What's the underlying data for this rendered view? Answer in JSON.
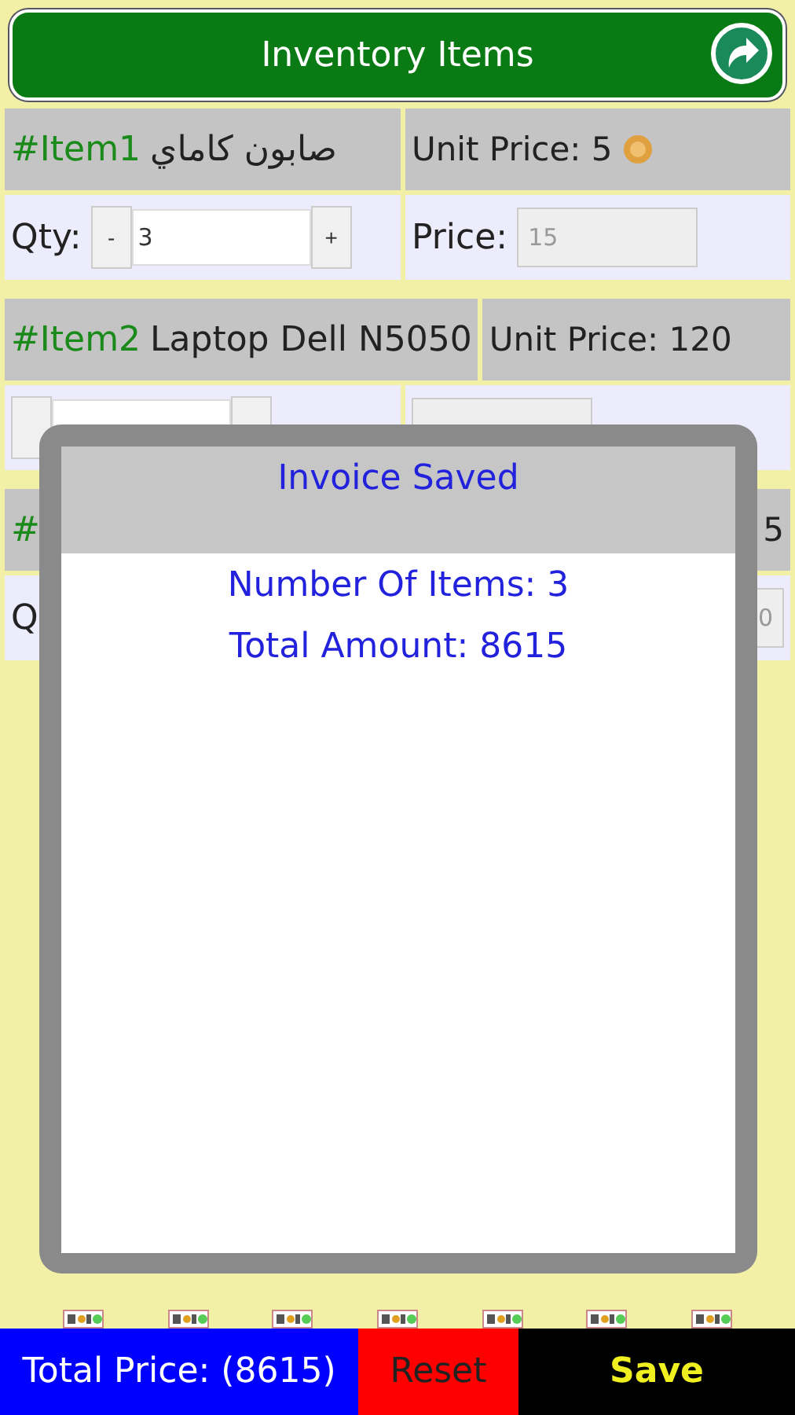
{
  "header": {
    "title": "Inventory Items"
  },
  "items": [
    {
      "tag": "#Item1",
      "name": "صابون كاماي",
      "unit_price": "Unit Price: 5",
      "currency_icon": true,
      "qty": {
        "label": "Qty:",
        "minus": "-",
        "value": "3",
        "plus": "+"
      },
      "price": {
        "label": "Price:",
        "value": "15"
      }
    },
    {
      "tag": "#Item2",
      "name": "Laptop Dell N5050",
      "unit_price": "Unit Price: 120"
    },
    {
      "kind": "covered",
      "tag": "#",
      "unit_price": "5",
      "qty": {
        "label": "Q"
      },
      "price": {
        "value": "0"
      }
    }
  ],
  "dialog": {
    "title": "Invoice Saved",
    "lines": [
      "Number Of Items: 3",
      "Total Amount: 8615"
    ]
  },
  "footer": {
    "total": "Total Price: (8615)",
    "reset": "Reset",
    "save": "Save"
  }
}
